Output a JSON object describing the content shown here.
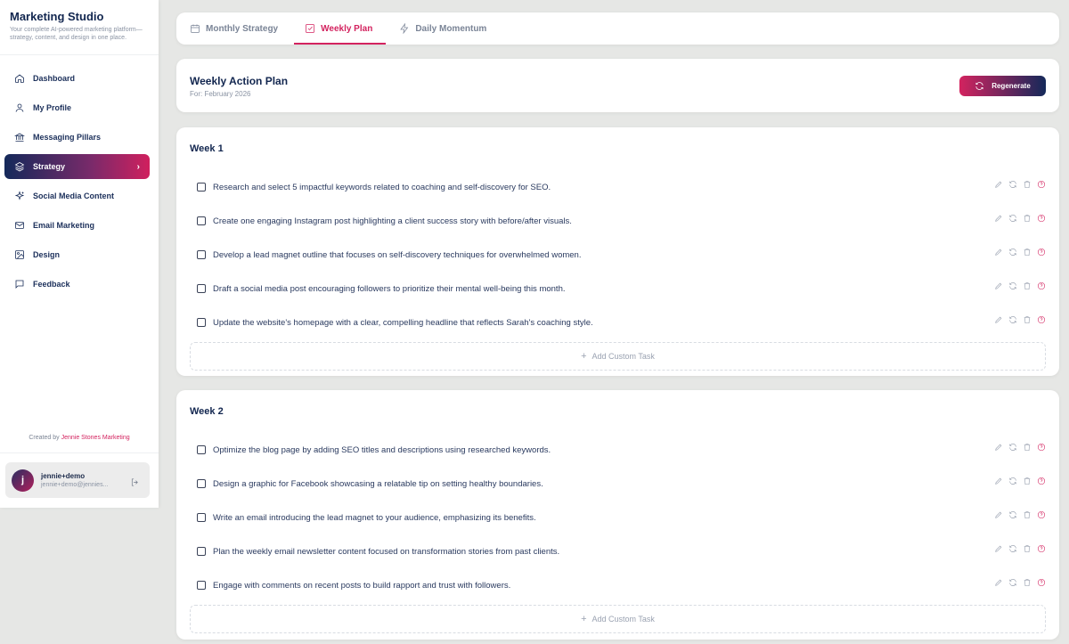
{
  "brand": {
    "title": "Marketing Studio",
    "subtitle": "Your complete AI-powered marketing platform—strategy, content, and design in one place."
  },
  "nav": {
    "items": [
      {
        "label": "Dashboard",
        "icon": "home-icon"
      },
      {
        "label": "My Profile",
        "icon": "user-icon"
      },
      {
        "label": "Messaging Pillars",
        "icon": "pillars-icon"
      },
      {
        "label": "Strategy",
        "icon": "layers-icon",
        "active": true
      },
      {
        "label": "Social Media Content",
        "icon": "sparkles-icon"
      },
      {
        "label": "Email Marketing",
        "icon": "mail-icon"
      },
      {
        "label": "Design",
        "icon": "image-icon"
      },
      {
        "label": "Feedback",
        "icon": "chat-icon"
      }
    ]
  },
  "credit": {
    "prefix": "Created by",
    "link": "Jennie Stones Marketing"
  },
  "user": {
    "initial": "j",
    "name": "jennie+demo",
    "email": "jennie+demo@jennies..."
  },
  "tabs": [
    {
      "label": "Monthly Strategy",
      "icon": "calendar-icon"
    },
    {
      "label": "Weekly Plan",
      "icon": "check-square-icon",
      "active": true
    },
    {
      "label": "Daily Momentum",
      "icon": "lightning-icon"
    }
  ],
  "plan": {
    "title": "Weekly Action Plan",
    "subtitle": "For: February 2026",
    "regenerate_label": "Regenerate"
  },
  "add_task_label": "Add Custom Task",
  "weeks": [
    {
      "title": "Week 1",
      "tasks": [
        "Research and select 5 impactful keywords related to coaching and self-discovery for SEO.",
        "Create one engaging Instagram post highlighting a client success story with before/after visuals.",
        "Develop a lead magnet outline that focuses on self-discovery techniques for overwhelmed women.",
        "Draft a social media post encouraging followers to prioritize their mental well-being this month.",
        "Update the website's homepage with a clear, compelling headline that reflects Sarah's coaching style."
      ]
    },
    {
      "title": "Week 2",
      "tasks": [
        "Optimize the blog page by adding SEO titles and descriptions using researched keywords.",
        "Design a graphic for Facebook showcasing a relatable tip on setting healthy boundaries.",
        "Write an email introducing the lead magnet to your audience, emphasizing its benefits.",
        "Plan the weekly email newsletter content focused on transformation stories from past clients.",
        "Engage with comments on recent posts to build rapport and trust with followers."
      ]
    }
  ],
  "colors": {
    "accent": "#d3235f",
    "navy": "#14295a",
    "background": "#e6e7e5"
  }
}
